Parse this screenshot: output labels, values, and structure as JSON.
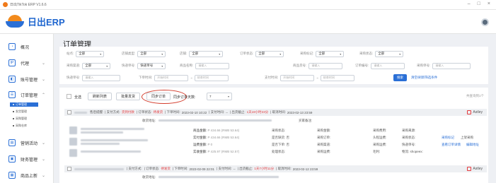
{
  "titlebar": {
    "title": "日出TikTok ERP V1.6.6"
  },
  "header": {
    "logo_text": "日出ERP"
  },
  "sidebar": {
    "items": [
      {
        "label": "概况",
        "icon": "dashboard-icon"
      },
      {
        "label": "代理",
        "icon": "proxy-icon"
      },
      {
        "label": "账号管理",
        "icon": "account-icon"
      },
      {
        "label": "订单管理",
        "icon": "order-icon"
      },
      {
        "label": "营销活动",
        "icon": "marketing-icon"
      },
      {
        "label": "财务管理",
        "icon": "finance-icon"
      },
      {
        "label": "商品上新",
        "icon": "product-icon"
      }
    ],
    "sub_items": [
      "订单管理",
      "发货管理",
      "采购管理",
      "采购仓库"
    ]
  },
  "page": {
    "title": "订单管理"
  },
  "filters": {
    "row1": [
      {
        "label": "站点:",
        "value": "全部"
      },
      {
        "label": "店铺类型:",
        "value": "全部"
      },
      {
        "label": "店铺:",
        "value": "全部"
      },
      {
        "label": "订单状态:",
        "value": "全部"
      },
      {
        "label": "采购标记:",
        "value": "全部"
      },
      {
        "label": "采购状态:",
        "value": "全部"
      }
    ],
    "row2": [
      {
        "label": "采购渠道:",
        "value": "全部"
      },
      {
        "label": "快递单号:",
        "value": "快递单号"
      },
      {
        "label": "商品名称:",
        "value": "请输入"
      },
      {
        "label": "商品货号:",
        "value": "请输入"
      },
      {
        "label": "订单编号:",
        "value": "请输入"
      },
      {
        "label": "采购单号:",
        "value": "请输入"
      }
    ],
    "row3": [
      {
        "label": "快递单号:",
        "value": "请输入"
      },
      {
        "label": "下单时间:",
        "value": "开始时间"
      },
      {
        "label": "~",
        "value": "结束时间"
      },
      {
        "label": "支付时间:",
        "value": "开始时间"
      },
      {
        "label": "~",
        "value": "结束时间"
      }
    ],
    "search_label": "搜索",
    "reset_label": "清空/刷新筛选条件"
  },
  "toolbar": {
    "select_all": "全选",
    "refresh_list": "刷新列表",
    "batch_ship": "批量发货",
    "sync_orders": "同步订单",
    "sync_days_label": "同步订单天数:",
    "sync_days_value": "7",
    "column_hint": "共查询到1个"
  },
  "orders": [
    {
      "bar": {
        "shop": "售后提醒:",
        "pay_method_label": "| 支付方式:",
        "pay_method": "货到付款",
        "status_label": "| 订单状态:",
        "status": "待发货",
        "order_time_label": "| 下单时间:",
        "order_time": "2023-02-10 10:22",
        "pay_time_label": "| 支付时间:",
        "pay_time": "--",
        "deadline_label": "| 出货截止:",
        "deadline": "1天19小时23分",
        "cancel_label": "| 取消时间:",
        "cancel_time": "2023-02-13 23:59",
        "user": "Astley"
      },
      "address_label": "收货地址:",
      "buyer_note_label": "买家备注:",
      "amounts": [
        {
          "label": "商品金额:",
          "value": "P 434.66 (RMB 53.64)"
        },
        {
          "label": "实付金额:",
          "value": "P 434.66 (RMB 53.64)"
        },
        {
          "label": "运费金额:",
          "value": "P 0"
        },
        {
          "label": "实收金额:",
          "value": "P 425.97 (RMB 52.57)"
        }
      ],
      "purchase": [
        {
          "label": "采购状态:",
          "value": ""
        },
        {
          "label": "是否缺货:",
          "value": "否"
        },
        {
          "label": "是否下单:",
          "value": "否"
        },
        {
          "label": "处理状态:",
          "value": ""
        }
      ],
      "purchase2": [
        {
          "label": "采购金额:",
          "value": ""
        },
        {
          "label": "采购订单:",
          "value": ""
        },
        {
          "label": "采购渠道:",
          "value": ""
        },
        {
          "label": "采购运费:",
          "value": ""
        }
      ],
      "purchase3": [
        {
          "label": "采购费用:",
          "value": ""
        },
        {
          "label": "头程运费:",
          "value": ""
        },
        {
          "label": "采购运费:",
          "value": ""
        },
        {
          "label": "毛利:",
          "value": ""
        }
      ],
      "purchase4": [
        {
          "label": "采购来源:",
          "value": ""
        },
        {
          "label": "采购状态:",
          "value": ""
        },
        {
          "label": "快递单号:",
          "value": ""
        },
        {
          "label": "物流:",
          "value": "shopeex:"
        }
      ],
      "actions": {
        "mark": "采购标记",
        "upload": "上架采购",
        "view_detail": "查看订单详情",
        "edit": "编辑地址"
      }
    },
    {
      "bar": {
        "pay_method_label": "| 支付方式:",
        "pay_method": "",
        "status_label": "| 订单状态:",
        "status": "待发货",
        "order_time_label": "| 下单时间:",
        "order_time": "2023-02-09 22:01",
        "pay_time_label": "| 支付时间:",
        "pay_time": "--",
        "deadline_label": "| 出货截止:",
        "deadline": "1天7小时11分",
        "cancel_label": "| 取消时间:",
        "cancel_time": "2023-02-12 23:59",
        "user": "Astley"
      },
      "address_label": "收货地址:"
    }
  ],
  "colors": {
    "accent": "#2a6fd6",
    "danger": "#e4393c",
    "brand_orange": "#f28a1c"
  }
}
